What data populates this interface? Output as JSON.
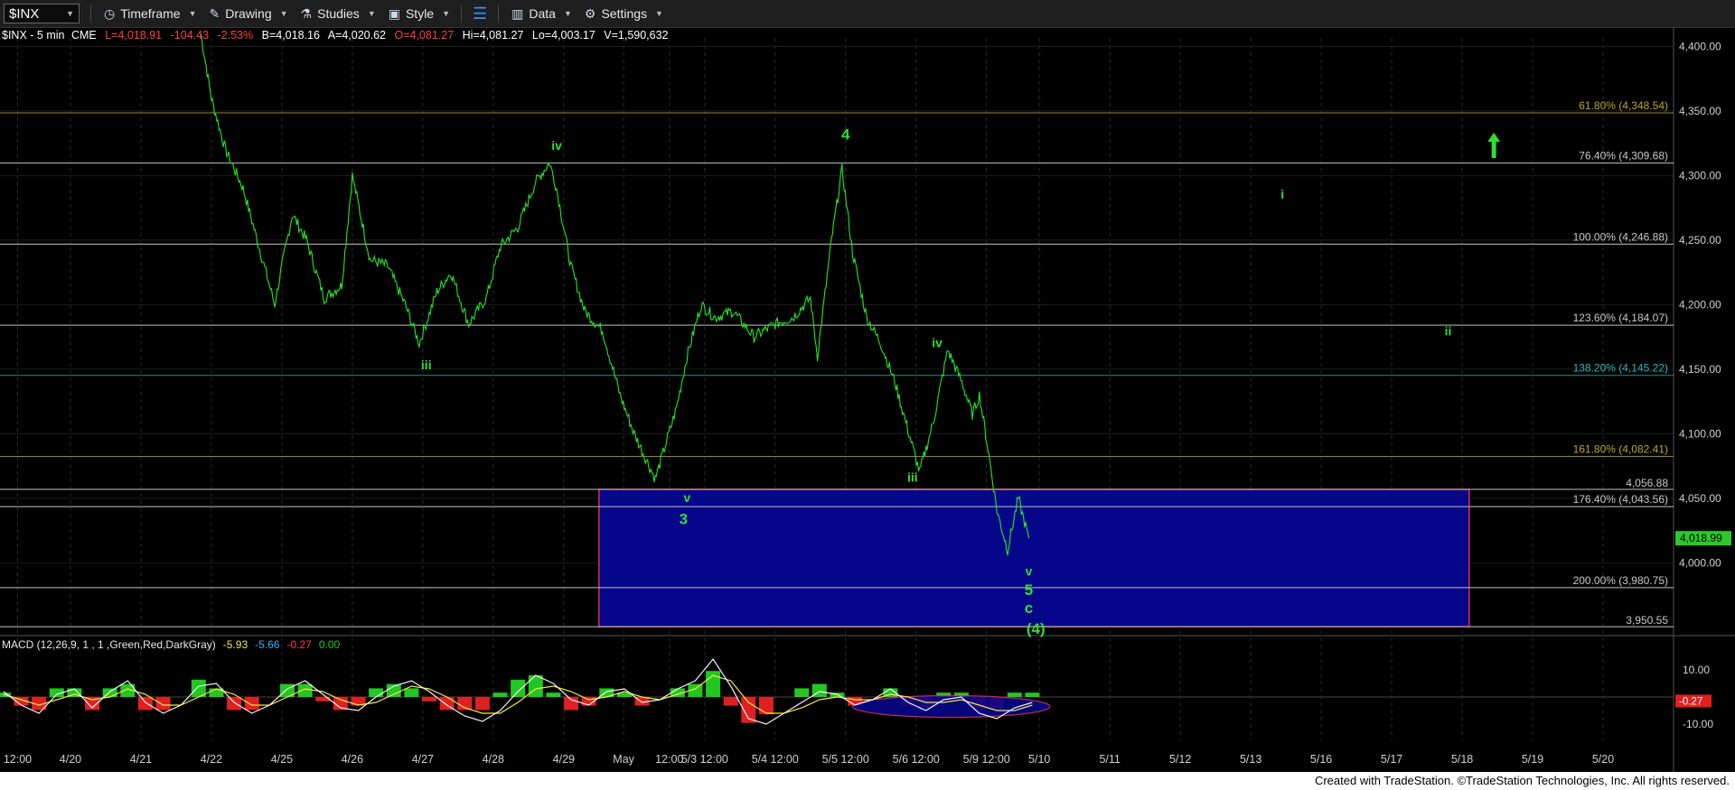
{
  "toolbar": {
    "symbol": "$INX",
    "timeframe": "Timeframe",
    "drawing": "Drawing",
    "studies": "Studies",
    "style": "Style",
    "data": "Data",
    "settings": "Settings"
  },
  "header": {
    "symbol": "$INX - 5 min",
    "exchange": "CME",
    "last": "L=4,018.91",
    "change": "-104.43",
    "change_pct": "-2.53%",
    "bid": "B=4,018.16",
    "ask": "A=4,020.62",
    "open": "O=4,081.27",
    "high": "Hi=4,081.27",
    "low": "Lo=4,003.17",
    "volume": "V=1,590,632"
  },
  "colors": {
    "price_line": "#22e622",
    "wave_label": "#33dd33",
    "box_fill": "#06068a",
    "box_border": "#d1305a",
    "fib_line": "#c2c2c2",
    "fib_line_olive": "#8a8a30",
    "fib_line_teal": "#2a8a8a",
    "macd_line": "#f2f2f2",
    "signal_line": "#f2e64a",
    "hist_pos": "#22c822",
    "hist_neg": "#e02020"
  },
  "chart_data": {
    "type": "line",
    "price_axis": {
      "ylim": [
        3945,
        4415
      ],
      "ticks": [
        4000,
        4050,
        4100,
        4150,
        4200,
        4250,
        4300,
        4350,
        4400
      ],
      "tick_labels": [
        "4,000.00",
        "4,050.00",
        "4,100.00",
        "4,150.00",
        "4,200.00",
        "4,250.00",
        "4,300.00",
        "4,350.00",
        "4,400.00"
      ],
      "last_price_label": "4,018.99"
    },
    "time_axis": {
      "tick_labels": [
        "12:00",
        "4/20",
        "4/21",
        "4/22",
        "4/25",
        "4/26",
        "4/27",
        "4/28",
        "4/29",
        "May",
        "12:00",
        "5/3 12:00",
        "5/4 12:00",
        "5/5 12:00",
        "5/6 12:00",
        "5/9 12:00",
        "5/10",
        "5/11",
        "5/12",
        "5/13",
        "5/16",
        "5/17",
        "5/18",
        "5/19",
        "5/20"
      ],
      "tick_index": [
        0.5,
        2,
        4,
        6,
        8,
        10,
        12,
        14,
        16,
        17.7,
        19,
        20,
        22,
        24,
        26,
        28,
        29.5,
        31.5,
        33.5,
        35.5,
        37.5,
        39.5,
        41.5,
        43.5,
        45.5
      ],
      "visible_range_index": [
        0,
        47.5
      ]
    },
    "series": [
      {
        "name": "$INX - 5 min",
        "x_index": [
          5.7,
          6.0,
          6.4,
          6.9,
          7.4,
          7.8,
          8.0,
          8.3,
          8.7,
          9.2,
          9.7,
          10.0,
          10.5,
          11.0,
          11.5,
          11.9,
          12.4,
          12.8,
          13.3,
          13.8,
          14.2,
          14.7,
          15.2,
          15.6,
          15.8,
          16.2,
          16.6,
          17.1,
          17.6,
          18.0,
          18.6,
          19.2,
          19.5,
          19.9,
          20.3,
          20.8,
          21.4,
          22.0,
          22.5,
          23.0,
          23.2,
          23.6,
          23.9,
          24.2,
          24.6,
          25.0,
          25.4,
          25.8,
          26.1,
          26.5,
          26.9,
          27.3,
          27.6,
          27.8,
          28.1,
          28.3,
          28.6,
          28.9,
          29.2
        ],
        "values": [
          4410,
          4360,
          4320,
          4290,
          4240,
          4200,
          4230,
          4270,
          4250,
          4205,
          4215,
          4300,
          4235,
          4230,
          4200,
          4170,
          4210,
          4225,
          4185,
          4205,
          4245,
          4260,
          4295,
          4310,
          4290,
          4230,
          4195,
          4180,
          4130,
          4100,
          4065,
          4120,
          4160,
          4200,
          4190,
          4195,
          4175,
          4185,
          4190,
          4205,
          4160,
          4250,
          4305,
          4240,
          4190,
          4170,
          4140,
          4100,
          4070,
          4110,
          4165,
          4140,
          4115,
          4130,
          4078,
          4040,
          4010,
          4050,
          4019
        ]
      }
    ],
    "fib_levels": [
      {
        "pct": "61.80%",
        "value": 4348.54,
        "label": "61.80% (4,348.54)",
        "color": "olive"
      },
      {
        "pct": "76.40%",
        "value": 4309.68,
        "label": "76.40% (4,309.68)",
        "color": "gray"
      },
      {
        "pct": "100.00%",
        "value": 4246.88,
        "label": "100.00% (4,246.88)",
        "color": "gray"
      },
      {
        "pct": "123.60%",
        "value": 4184.07,
        "label": "123.60% (4,184.07)",
        "color": "gray"
      },
      {
        "pct": "138.20%",
        "value": 4145.22,
        "label": "138.20% (4,145.22)",
        "color": "teal"
      },
      {
        "pct": "161.80%",
        "value": 4082.41,
        "label": "161.80% (4,082.41)",
        "color": "olive"
      },
      {
        "pct": "176.40%",
        "value": 4043.56,
        "label": "176.40% (4,043.56)",
        "color": "gray"
      },
      {
        "pct": "200.00%",
        "value": 3980.75,
        "label": "200.00% (3,980.75)",
        "color": "gray"
      }
    ],
    "box": {
      "x_index": [
        17.0,
        41.7
      ],
      "y_range": [
        3950.55,
        4056.88
      ],
      "top_label": "4,056.88",
      "bottom_label": "3,950.55"
    },
    "wave_labels": [
      {
        "text": "iii",
        "x_index": 12.1,
        "y": 4150,
        "size": "small"
      },
      {
        "text": "iv",
        "x_index": 15.8,
        "y": 4320,
        "size": "small"
      },
      {
        "text": "v",
        "x_index": 19.5,
        "y": 4047,
        "size": "small"
      },
      {
        "text": "3",
        "x_index": 19.4,
        "y": 4030,
        "size": "large"
      },
      {
        "text": "4",
        "x_index": 24.0,
        "y": 4328,
        "size": "large"
      },
      {
        "text": "iii",
        "x_index": 25.9,
        "y": 4063,
        "size": "small"
      },
      {
        "text": "iv",
        "x_index": 26.6,
        "y": 4167,
        "size": "small"
      },
      {
        "text": "v",
        "x_index": 29.2,
        "y": 3990,
        "size": "small"
      },
      {
        "text": "5",
        "x_index": 29.2,
        "y": 3975,
        "size": "large"
      },
      {
        "text": "c",
        "x_index": 29.2,
        "y": 3961,
        "size": "large"
      },
      {
        "text": "(4)",
        "x_index": 29.4,
        "y": 3945,
        "size": "large"
      },
      {
        "text": "i",
        "x_index": 36.4,
        "y": 4282,
        "size": "small"
      },
      {
        "text": "ii",
        "x_index": 41.1,
        "y": 4176,
        "size": "small"
      }
    ],
    "arrow": {
      "x_index": 42.4,
      "y": 4322,
      "direction": "up"
    },
    "macd": {
      "legend": "MACD (12,26,9, 1 , 1 ,Green,Red,DarkGray)",
      "values": [
        "-5.93",
        "-5.66",
        "-0.27",
        "0.00"
      ],
      "ylim": [
        -16,
        16
      ],
      "ticks": [
        10,
        -10
      ],
      "tick_labels": [
        "10.00",
        "-10.00"
      ],
      "last_label": "-0.27",
      "macd_line": [
        2,
        -3,
        -6,
        1,
        3,
        -4,
        2,
        6,
        -2,
        -6,
        -3,
        4,
        5,
        -2,
        -6,
        -3,
        3,
        6,
        1,
        -4,
        -5,
        0,
        4,
        6,
        2,
        -3,
        -7,
        -9,
        -5,
        2,
        8,
        5,
        -1,
        -3,
        2,
        3,
        -2,
        -1,
        3,
        6,
        14,
        4,
        -8,
        -10,
        -6,
        -2,
        2,
        1,
        -3,
        -1,
        3,
        -2,
        -5,
        -1,
        0,
        -6,
        -8,
        -4,
        -2
      ],
      "signal_line": [
        1,
        -1,
        -3,
        -1,
        1,
        -1,
        0,
        3,
        1,
        -3,
        -3,
        0,
        3,
        1,
        -3,
        -3,
        0,
        3,
        2,
        -1,
        -3,
        -2,
        1,
        4,
        3,
        0,
        -4,
        -6,
        -6,
        -2,
        3,
        4,
        2,
        -1,
        0,
        2,
        0,
        -1,
        1,
        3,
        8,
        6,
        -2,
        -6,
        -6,
        -4,
        -1,
        0,
        -1,
        -1,
        1,
        0,
        -2,
        -2,
        -1,
        -3,
        -5,
        -5,
        -3
      ]
    },
    "footer": "Created with TradeStation. ©TradeStation Technologies, Inc. All rights reserved."
  }
}
